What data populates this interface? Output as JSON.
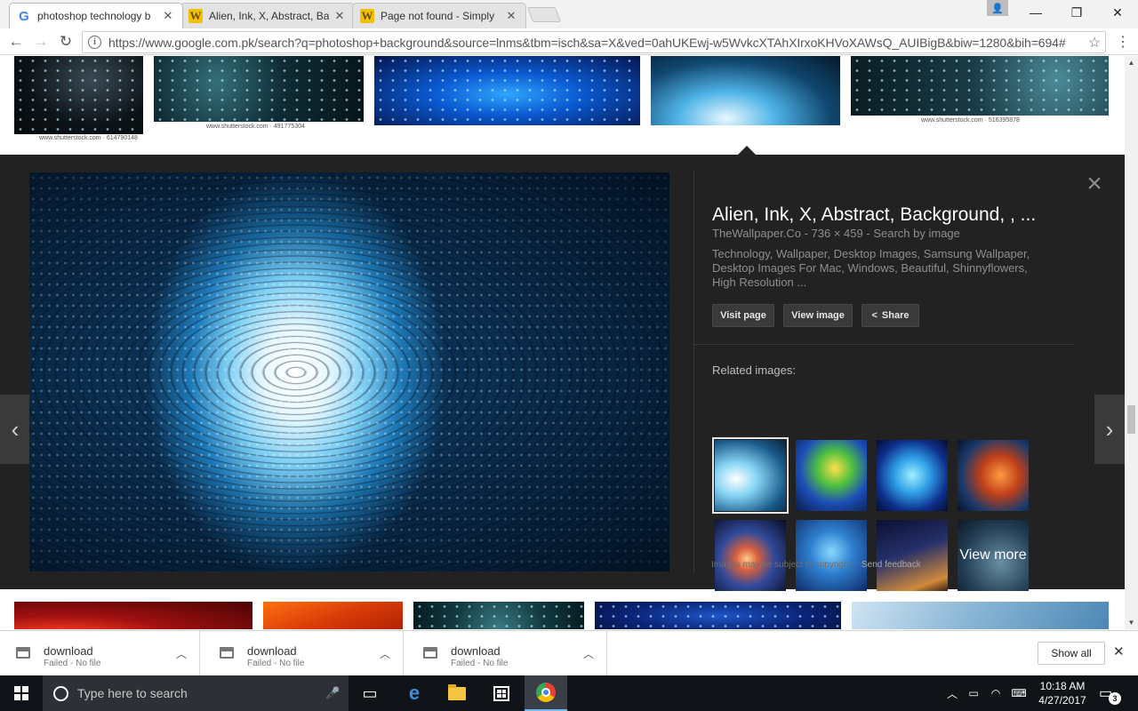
{
  "browser": {
    "tabs": [
      {
        "title": "photoshop technology b",
        "favicon": "google-icon",
        "active": true
      },
      {
        "title": "Alien, Ink, X, Abstract, Ba",
        "favicon": "w-icon",
        "active": false
      },
      {
        "title": "Page not found - Simply",
        "favicon": "w-icon",
        "active": false
      }
    ],
    "url": "https://www.google.com.pk/search?q=photoshop+background&source=lnms&tbm=isch&sa=X&ved=0ahUKEwj-w5WvkcXTAhXIrxoKHVoXAWsQ_AUIBigB&biw=1280&bih=694#"
  },
  "results_top": [
    {
      "caption": "www.shutterstock.com · 614790148"
    },
    {
      "caption": "www.shutterstock.com · 491775304"
    },
    {
      "caption": ""
    },
    {
      "caption": ""
    },
    {
      "caption": "www.shutterstock.com · 516395878"
    }
  ],
  "preview": {
    "title": "Alien, Ink, X, Abstract, Background, , ...",
    "source": "TheWallpaper.Co",
    "dimensions": "736 × 459",
    "search_by_image": "Search by image",
    "description": "Technology, Wallpaper, Desktop Images, Samsung Wallpaper, Desktop Images For Mac, Windows, Beautiful, Shinnyflowers, High Resolution ...",
    "buttons": {
      "visit": "Visit page",
      "view": "View image",
      "share": "Share"
    },
    "related_label": "Related images:",
    "view_more": "View more",
    "copyright": "Images may be subject to copyright.",
    "feedback": "Send feedback"
  },
  "downloads": [
    {
      "name": "download",
      "status": "Failed - No file"
    },
    {
      "name": "download",
      "status": "Failed - No file"
    },
    {
      "name": "download",
      "status": "Failed - No file"
    }
  ],
  "show_all": "Show all",
  "taskbar": {
    "search_placeholder": "Type here to search",
    "time": "10:18 AM",
    "date": "4/27/2017",
    "notification_count": "3"
  }
}
